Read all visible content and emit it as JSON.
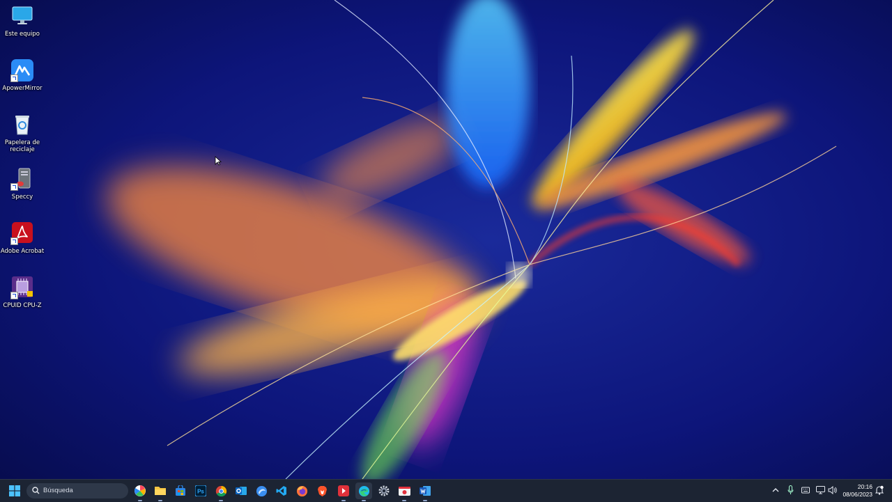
{
  "desktop": {
    "icons": [
      {
        "label": "Este equipo",
        "icon": "monitor-icon"
      },
      {
        "label": "ApowerMirror",
        "icon": "apowermirror-icon"
      },
      {
        "label": "Papelera de reciclaje",
        "icon": "recycle-bin-icon"
      },
      {
        "label": "Speccy",
        "icon": "speccy-icon"
      },
      {
        "label": "Adobe Acrobat",
        "icon": "acrobat-icon"
      },
      {
        "label": "CPUID CPU-Z",
        "icon": "cpuz-icon"
      }
    ]
  },
  "taskbar": {
    "search_placeholder": "Búsqueda",
    "apps": [
      "start-icon",
      "widgets-icon",
      "file-explorer-icon",
      "microsoft-store-icon",
      "photoshop-icon",
      "chrome-icon",
      "outlook-icon",
      "browser-icon",
      "vscode-icon",
      "firefox-icon",
      "brave-icon",
      "screen-recorder-icon",
      "edge-icon",
      "settings-icon",
      "snipping-tool-icon",
      "word-icon"
    ],
    "tray": {
      "time": "20:16",
      "date": "08/06/2023",
      "icons": [
        "chevron-up-icon",
        "microphone-icon",
        "keyboard-icon",
        "network-icon",
        "volume-icon",
        "notification-icon"
      ]
    }
  },
  "colors": {
    "background": "#0a1160",
    "taskbar": "#1c2433",
    "accent": "#0078d4"
  }
}
